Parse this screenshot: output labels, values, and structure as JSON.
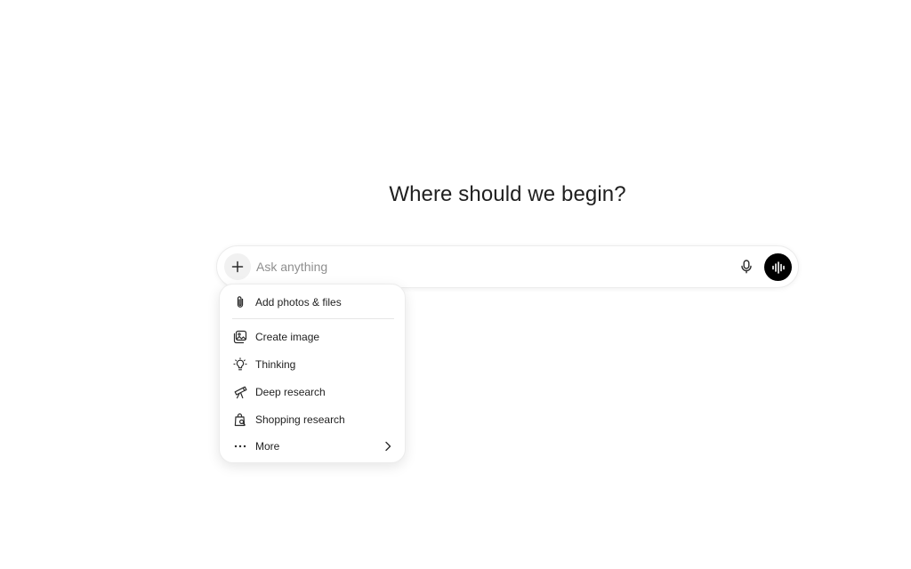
{
  "main": {
    "headline": "Where should we begin?"
  },
  "composer": {
    "placeholder": "Ask anything",
    "value": "",
    "plus_icon": "plus-icon",
    "mic_icon": "microphone-icon",
    "voice_icon": "voice-waveform-icon"
  },
  "menu": {
    "items": [
      {
        "label": "Add photos & files",
        "icon": "paperclip-icon"
      },
      {
        "label": "Create image",
        "icon": "image-stack-icon"
      },
      {
        "label": "Thinking",
        "icon": "lightbulb-icon"
      },
      {
        "label": "Deep research",
        "icon": "telescope-icon"
      },
      {
        "label": "Shopping research",
        "icon": "shopping-bag-search-icon"
      },
      {
        "label": "More",
        "icon": "ellipsis-icon",
        "trailing_icon": "chevron-right-icon"
      }
    ]
  },
  "colors": {
    "background": "#ffffff",
    "voice_button": "#000000",
    "text": "#1f1f1f",
    "placeholder": "#8f8f8f"
  }
}
